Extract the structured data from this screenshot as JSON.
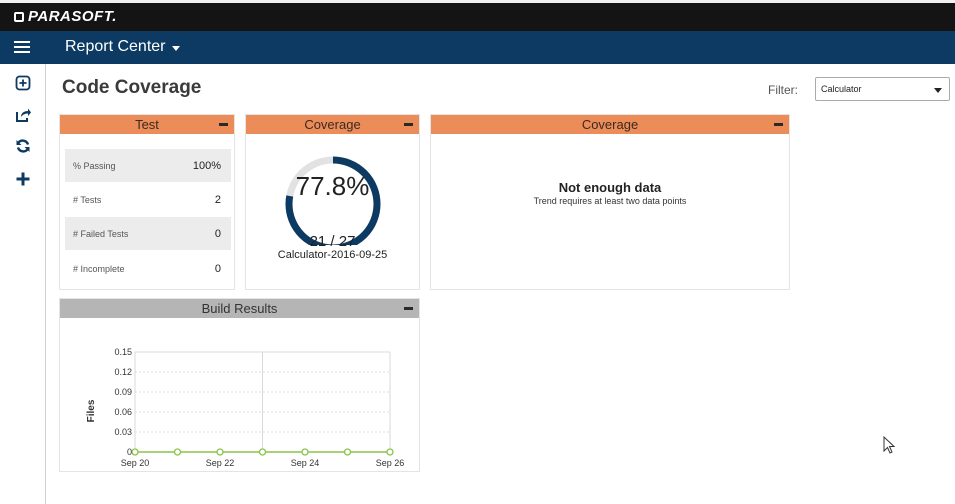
{
  "brand": {
    "name": "PARASOFT."
  },
  "navbar": {
    "title": "Report Center"
  },
  "sidebar": {
    "items": [
      {
        "icon": "expand-square-icon"
      },
      {
        "icon": "share-export-icon"
      },
      {
        "icon": "refresh-icon"
      },
      {
        "icon": "add-icon"
      }
    ]
  },
  "page": {
    "title": "Code Coverage"
  },
  "filter": {
    "label": "Filter:",
    "value": "Calculator"
  },
  "test_panel": {
    "title": "Test",
    "rows": [
      {
        "label": "% Passing",
        "value": "100%"
      },
      {
        "label": "# Tests",
        "value": "2"
      },
      {
        "label": "# Failed Tests",
        "value": "0"
      },
      {
        "label": "# Incomplete",
        "value": "0"
      }
    ]
  },
  "coverage_panel": {
    "title": "Coverage",
    "percent_label": "77.8%",
    "percent": 77.8,
    "ratio": "21 / 27",
    "build": "Calculator-2016-09-25"
  },
  "trend_panel": {
    "title": "Coverage",
    "message": "Not enough data",
    "sub_message": "Trend requires at least two data points"
  },
  "build_panel": {
    "title": "Build Results"
  },
  "chart_data": {
    "type": "line",
    "ylabel": "Files",
    "yticks": [
      "0",
      "0.03",
      "0.06",
      "0.09",
      "0.12",
      "0.15"
    ],
    "ylim": [
      0,
      0.15
    ],
    "xticks": [
      "Sep 20",
      "Sep 22",
      "Sep 24",
      "Sep 26"
    ],
    "x": [
      "Sep 20",
      "Sep 21",
      "Sep 22",
      "Sep 23",
      "Sep 24",
      "Sep 25",
      "Sep 26"
    ],
    "series": [
      {
        "values": [
          0,
          0,
          0,
          0,
          0,
          0,
          0
        ],
        "color": "#8bc34a"
      }
    ],
    "grid": true
  },
  "colors": {
    "accent": "#ec8c59",
    "navbar": "#0d3a62",
    "gauge": "#0d3a62",
    "gauge_track": "#e2e2e2",
    "series": "#8bc34a"
  }
}
